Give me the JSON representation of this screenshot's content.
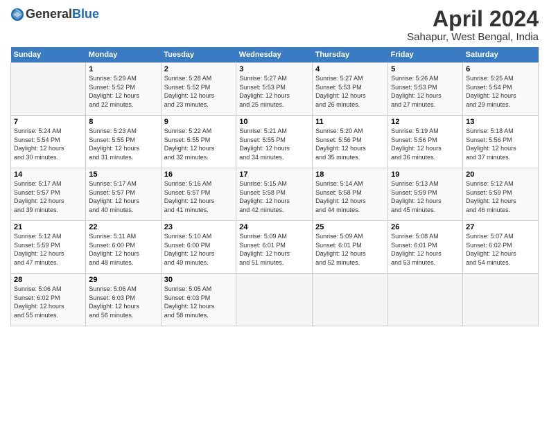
{
  "header": {
    "logo_general": "General",
    "logo_blue": "Blue",
    "title": "April 2024",
    "location": "Sahapur, West Bengal, India"
  },
  "calendar": {
    "days_of_week": [
      "Sunday",
      "Monday",
      "Tuesday",
      "Wednesday",
      "Thursday",
      "Friday",
      "Saturday"
    ],
    "weeks": [
      [
        {
          "day": "",
          "info": ""
        },
        {
          "day": "1",
          "info": "Sunrise: 5:29 AM\nSunset: 5:52 PM\nDaylight: 12 hours\nand 22 minutes."
        },
        {
          "day": "2",
          "info": "Sunrise: 5:28 AM\nSunset: 5:52 PM\nDaylight: 12 hours\nand 23 minutes."
        },
        {
          "day": "3",
          "info": "Sunrise: 5:27 AM\nSunset: 5:53 PM\nDaylight: 12 hours\nand 25 minutes."
        },
        {
          "day": "4",
          "info": "Sunrise: 5:27 AM\nSunset: 5:53 PM\nDaylight: 12 hours\nand 26 minutes."
        },
        {
          "day": "5",
          "info": "Sunrise: 5:26 AM\nSunset: 5:53 PM\nDaylight: 12 hours\nand 27 minutes."
        },
        {
          "day": "6",
          "info": "Sunrise: 5:25 AM\nSunset: 5:54 PM\nDaylight: 12 hours\nand 29 minutes."
        }
      ],
      [
        {
          "day": "7",
          "info": "Sunrise: 5:24 AM\nSunset: 5:54 PM\nDaylight: 12 hours\nand 30 minutes."
        },
        {
          "day": "8",
          "info": "Sunrise: 5:23 AM\nSunset: 5:55 PM\nDaylight: 12 hours\nand 31 minutes."
        },
        {
          "day": "9",
          "info": "Sunrise: 5:22 AM\nSunset: 5:55 PM\nDaylight: 12 hours\nand 32 minutes."
        },
        {
          "day": "10",
          "info": "Sunrise: 5:21 AM\nSunset: 5:55 PM\nDaylight: 12 hours\nand 34 minutes."
        },
        {
          "day": "11",
          "info": "Sunrise: 5:20 AM\nSunset: 5:56 PM\nDaylight: 12 hours\nand 35 minutes."
        },
        {
          "day": "12",
          "info": "Sunrise: 5:19 AM\nSunset: 5:56 PM\nDaylight: 12 hours\nand 36 minutes."
        },
        {
          "day": "13",
          "info": "Sunrise: 5:18 AM\nSunset: 5:56 PM\nDaylight: 12 hours\nand 37 minutes."
        }
      ],
      [
        {
          "day": "14",
          "info": "Sunrise: 5:17 AM\nSunset: 5:57 PM\nDaylight: 12 hours\nand 39 minutes."
        },
        {
          "day": "15",
          "info": "Sunrise: 5:17 AM\nSunset: 5:57 PM\nDaylight: 12 hours\nand 40 minutes."
        },
        {
          "day": "16",
          "info": "Sunrise: 5:16 AM\nSunset: 5:57 PM\nDaylight: 12 hours\nand 41 minutes."
        },
        {
          "day": "17",
          "info": "Sunrise: 5:15 AM\nSunset: 5:58 PM\nDaylight: 12 hours\nand 42 minutes."
        },
        {
          "day": "18",
          "info": "Sunrise: 5:14 AM\nSunset: 5:58 PM\nDaylight: 12 hours\nand 44 minutes."
        },
        {
          "day": "19",
          "info": "Sunrise: 5:13 AM\nSunset: 5:59 PM\nDaylight: 12 hours\nand 45 minutes."
        },
        {
          "day": "20",
          "info": "Sunrise: 5:12 AM\nSunset: 5:59 PM\nDaylight: 12 hours\nand 46 minutes."
        }
      ],
      [
        {
          "day": "21",
          "info": "Sunrise: 5:12 AM\nSunset: 5:59 PM\nDaylight: 12 hours\nand 47 minutes."
        },
        {
          "day": "22",
          "info": "Sunrise: 5:11 AM\nSunset: 6:00 PM\nDaylight: 12 hours\nand 48 minutes."
        },
        {
          "day": "23",
          "info": "Sunrise: 5:10 AM\nSunset: 6:00 PM\nDaylight: 12 hours\nand 49 minutes."
        },
        {
          "day": "24",
          "info": "Sunrise: 5:09 AM\nSunset: 6:01 PM\nDaylight: 12 hours\nand 51 minutes."
        },
        {
          "day": "25",
          "info": "Sunrise: 5:09 AM\nSunset: 6:01 PM\nDaylight: 12 hours\nand 52 minutes."
        },
        {
          "day": "26",
          "info": "Sunrise: 5:08 AM\nSunset: 6:01 PM\nDaylight: 12 hours\nand 53 minutes."
        },
        {
          "day": "27",
          "info": "Sunrise: 5:07 AM\nSunset: 6:02 PM\nDaylight: 12 hours\nand 54 minutes."
        }
      ],
      [
        {
          "day": "28",
          "info": "Sunrise: 5:06 AM\nSunset: 6:02 PM\nDaylight: 12 hours\nand 55 minutes."
        },
        {
          "day": "29",
          "info": "Sunrise: 5:06 AM\nSunset: 6:03 PM\nDaylight: 12 hours\nand 56 minutes."
        },
        {
          "day": "30",
          "info": "Sunrise: 5:05 AM\nSunset: 6:03 PM\nDaylight: 12 hours\nand 58 minutes."
        },
        {
          "day": "",
          "info": ""
        },
        {
          "day": "",
          "info": ""
        },
        {
          "day": "",
          "info": ""
        },
        {
          "day": "",
          "info": ""
        }
      ]
    ]
  }
}
